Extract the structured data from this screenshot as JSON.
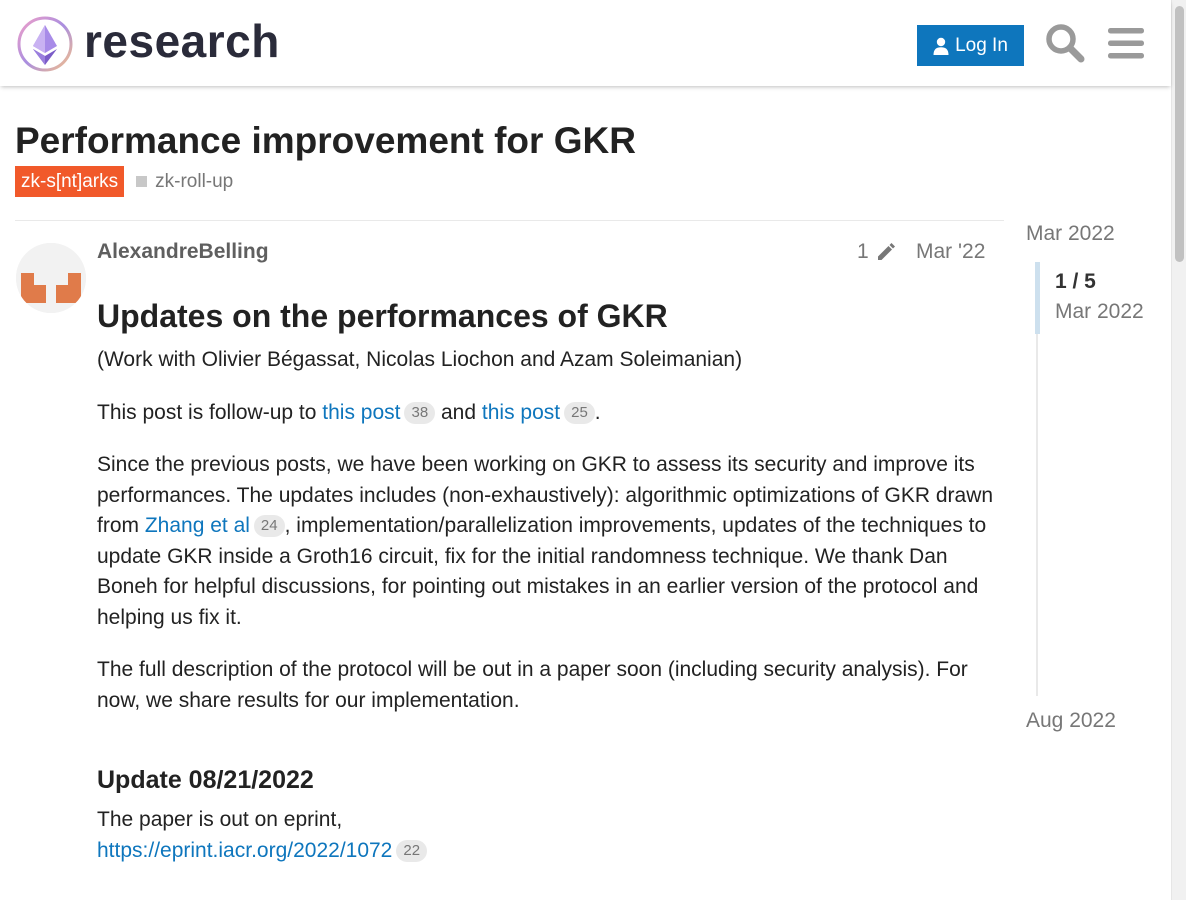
{
  "header": {
    "site_name": "research",
    "login_label": "Log In",
    "search_icon": "search-icon",
    "menu_icon": "hamburger-menu-icon",
    "brand_color": "#0e76bd"
  },
  "topic": {
    "title": "Performance improvement for GKR",
    "category": "zk-s[nt]arks",
    "category_color": "#f1592a",
    "tags": [
      "zk-roll-up"
    ]
  },
  "post": {
    "username": "AlexandreBelling",
    "edit_count": "1",
    "date": "Mar '22",
    "heading": "Updates on the performances of GKR",
    "p1": "(Work with Olivier Bégassat, Nicolas Liochon and Azam Soleimanian)",
    "p2_prefix": "This post is follow-up to ",
    "p2_link1": "this post",
    "p2_count1": "38",
    "p2_and": " and ",
    "p2_link2": "this post",
    "p2_count2": "25",
    "p2_suffix": ".",
    "p3_prefix": "Since the previous posts, we have been working on GKR to assess its security and improve its performances. The updates includes (non-exhaustively): algorithmic optimizations of GKR drawn from ",
    "p3_link": "Zhang et al",
    "p3_count": "24",
    "p3_suffix": ", implementation/parallelization improvements, updates of the techniques to update GKR inside a Groth16 circuit, fix for the initial randomness technique. We thank Dan Boneh for helpful discussions, for pointing out mistakes in an earlier version of the protocol and helping us fix it.",
    "p4": "The full description of the protocol will be out in a paper soon (including security analysis). For now, we share results for our implementation.",
    "update_heading": "Update 08/21/2022",
    "p5": "The paper is out on eprint,",
    "p5_link": "https://eprint.iacr.org/2022/1072",
    "p5_count": "22"
  },
  "timeline": {
    "start_label": "Mar 2022",
    "position": "1 / 5",
    "position_date": "Mar 2022",
    "end_label": "Aug 2022"
  }
}
